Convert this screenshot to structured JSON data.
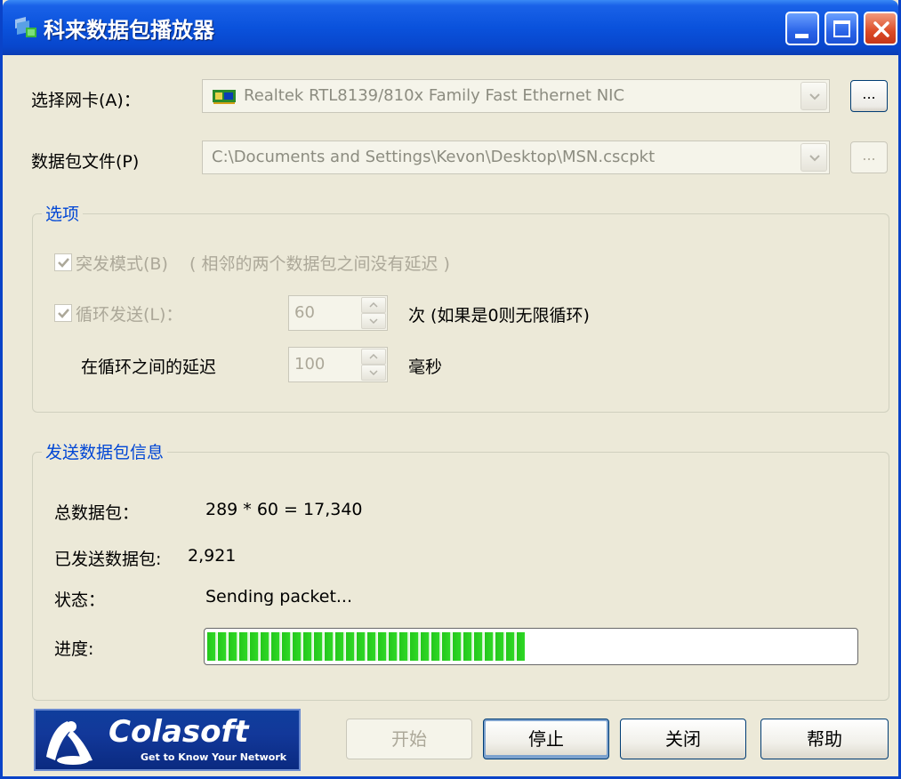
{
  "window": {
    "title": "科来数据包播放器"
  },
  "nic": {
    "label": "选择网卡(A)：",
    "value": "Realtek RTL8139/810x Family Fast Ethernet NIC",
    "browse": "..."
  },
  "file": {
    "label": "数据包文件(P)",
    "value": "C:\\Documents and Settings\\Kevon\\Desktop\\MSN.cscpkt",
    "browse": "..."
  },
  "options": {
    "title": "选项",
    "burst_label": "突发模式(B)",
    "burst_note": "( 相邻的两个数据包之间没有延迟 )",
    "loop_label": "循环发送(L)：",
    "loop_count": "60",
    "loop_suffix": "次 (如果是0则无限循环)",
    "delay_label": "在循环之间的延迟",
    "delay_value": "100",
    "delay_unit": "毫秒"
  },
  "info": {
    "title": "发送数据包信息",
    "total_label": "总数据包：",
    "total_value": "289 * 60 = 17,340",
    "sent_label": "已发送数据包:",
    "sent_value": "2,921",
    "status_label": "状态：",
    "status_value": "Sending packet...",
    "progress_label": "进度:",
    "progress_fraction": 0.49
  },
  "logo": {
    "name": "Colasoft",
    "tagline": "Get to Know Your Network"
  },
  "buttons": {
    "start": "开始",
    "stop": "停止",
    "close": "关闭",
    "help": "帮助"
  },
  "colors": {
    "titlebar": "#0a52dc",
    "group_title": "#0046d5",
    "progress": "#2fd826",
    "face": "#ece9d8"
  }
}
